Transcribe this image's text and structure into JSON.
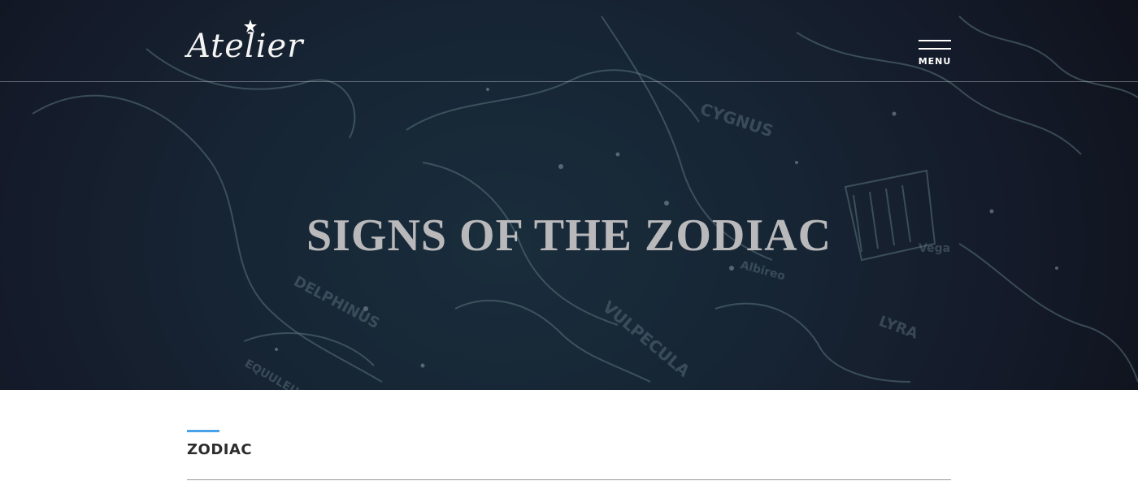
{
  "header": {
    "logo_text": "Atelier",
    "menu_label": "MENU"
  },
  "hero": {
    "title": "SIGNS OF THE ZODIAC",
    "constellation_labels": [
      "CYGNUS",
      "DELPHINUS",
      "VULPECULA",
      "LYRA",
      "EQUULEUS",
      "Vega",
      "Albireo"
    ]
  },
  "section": {
    "title": "ZODIAC"
  },
  "colors": {
    "accent": "#4aa3e8",
    "hero_text": "#b9b9bb",
    "header_text": "#ffffff"
  }
}
